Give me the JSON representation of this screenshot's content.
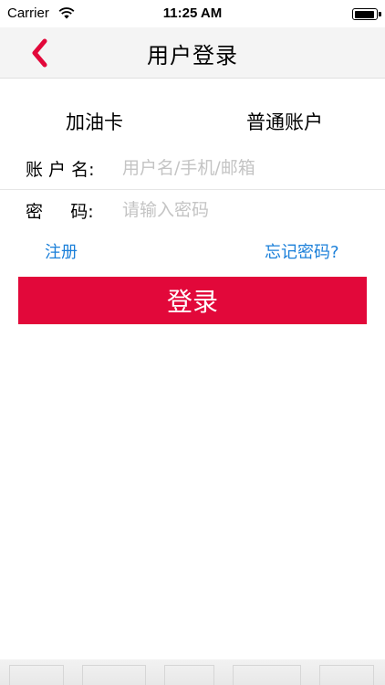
{
  "status_bar": {
    "carrier": "Carrier",
    "time": "11:25 AM",
    "wifi_icon": "wifi-icon",
    "battery_icon": "battery-icon"
  },
  "nav": {
    "back_icon": "chevron-left-icon",
    "title": "用户登录",
    "accent_color": "#e2083a"
  },
  "tabs": [
    {
      "label": "加油卡"
    },
    {
      "label": "普通账户"
    }
  ],
  "form": {
    "username": {
      "label": "账 户 名:",
      "placeholder": "用户名/手机/邮箱",
      "value": ""
    },
    "password": {
      "label": "密     码:",
      "placeholder": "请输入密码",
      "value": ""
    }
  },
  "links": {
    "register": "注册",
    "forgot_password": "忘记密码?",
    "link_color": "#1a7fd9"
  },
  "login_button": {
    "label": "登录",
    "color": "#e2083a"
  }
}
